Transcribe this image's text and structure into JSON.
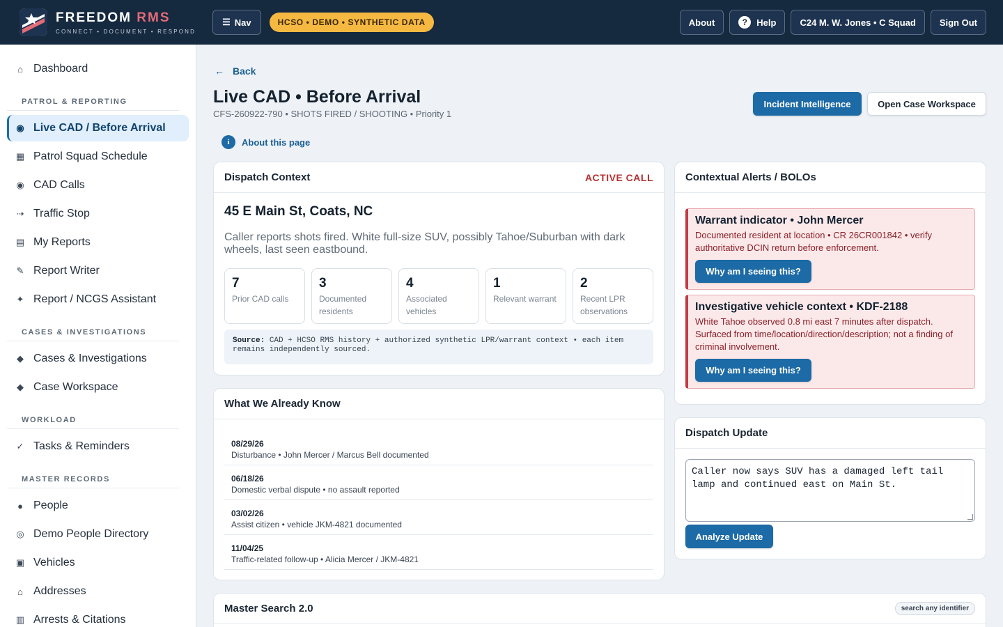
{
  "header": {
    "brand_main": "FREEDOM",
    "brand_accent": "RMS",
    "tagline": "CONNECT • DOCUMENT • RESPOND",
    "nav_label": "Nav",
    "demo_badge": "HCSO • DEMO • SYNTHETIC DATA",
    "about_label": "About",
    "help_label": "Help",
    "user_label": "C24 M. W. Jones • C Squad",
    "signout_label": "Sign Out"
  },
  "sidebar": {
    "dashboard": "Dashboard",
    "sections": {
      "patrol": "PATROL & REPORTING",
      "cases": "CASES & INVESTIGATIONS",
      "workload": "WORKLOAD",
      "master": "MASTER RECORDS"
    },
    "patrol_items": [
      "Live CAD / Before Arrival",
      "Patrol Squad Schedule",
      "CAD Calls",
      "Traffic Stop",
      "My Reports",
      "Report Writer",
      "Report / NCGS Assistant"
    ],
    "case_items": [
      "Cases & Investigations",
      "Case Workspace"
    ],
    "workload_items": [
      "Tasks & Reminders"
    ],
    "master_items": [
      "People",
      "Demo People Directory",
      "Vehicles",
      "Addresses",
      "Arrests & Citations"
    ]
  },
  "page": {
    "back_label": "Back",
    "title": "Live CAD • Before Arrival",
    "subtitle": "CFS-260922-790 • SHOTS FIRED / SHOOTING • Priority 1",
    "about_label": "About this page",
    "intel_button": "Incident Intelligence",
    "workspace_button": "Open Case Workspace"
  },
  "dispatch": {
    "heading": "Dispatch Context",
    "status": "ACTIVE CALL",
    "address": "45 E Main St, Coats, NC",
    "description": "Caller reports shots fired. White full-size SUV, possibly Tahoe/Suburban with dark wheels, last seen eastbound.",
    "stats": [
      {
        "num": "7",
        "label": "Prior CAD calls"
      },
      {
        "num": "3",
        "label": "Documented residents"
      },
      {
        "num": "4",
        "label": "Associated vehicles"
      },
      {
        "num": "1",
        "label": "Relevant warrant"
      },
      {
        "num": "2",
        "label": "Recent LPR observations"
      }
    ],
    "source_label": "Source:",
    "source_text": "CAD + HCSO RMS history + authorized synthetic LPR/warrant context • each item remains independently sourced."
  },
  "know": {
    "heading": "What We Already Know",
    "items": [
      {
        "date": "08/29/26",
        "text": "Disturbance • John Mercer / Marcus Bell documented"
      },
      {
        "date": "06/18/26",
        "text": "Domestic verbal dispute • no assault reported"
      },
      {
        "date": "03/02/26",
        "text": "Assist citizen • vehicle JKM-4821 documented"
      },
      {
        "date": "11/04/25",
        "text": "Traffic-related follow-up • Alicia Mercer / JKM-4821"
      }
    ]
  },
  "alerts": {
    "heading": "Contextual Alerts / BOLOs",
    "items": [
      {
        "title": "Warrant indicator • John Mercer",
        "body": "Documented resident at location • CR 26CR001842 • verify authoritative DCIN return before enforcement.",
        "button": "Why am I seeing this?"
      },
      {
        "title": "Investigative vehicle context • KDF-2188",
        "body": "White Tahoe observed 0.8 mi east 7 minutes after dispatch. Surfaced from time/location/direction/description; not a finding of criminal involvement.",
        "button": "Why am I seeing this?"
      }
    ]
  },
  "update": {
    "heading": "Dispatch Update",
    "text": "Caller now says SUV has a damaged left tail lamp and continued east on Main St.",
    "button": "Analyze Update"
  },
  "search": {
    "heading": "Master Search 2.0",
    "hint": "search any identifier"
  },
  "colors": {
    "header_bg": "#15293f",
    "accent_blue": "#1c6aa6",
    "demo_yellow": "#f5b942",
    "alert_red": "#c23b45"
  }
}
